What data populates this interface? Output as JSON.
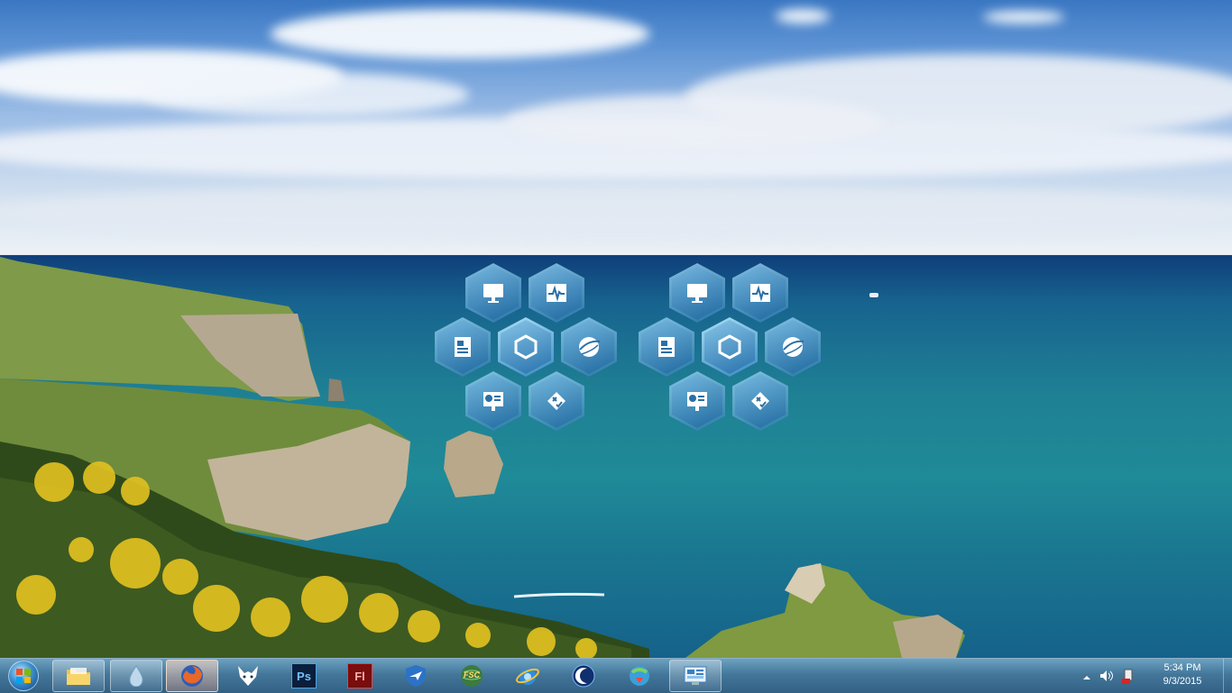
{
  "taskbar": {
    "start_button": "start-orb",
    "apps": [
      {
        "name": "Windows Explorer",
        "icon": "folder-icon"
      },
      {
        "name": "Droplet app",
        "icon": "droplet-icon"
      },
      {
        "name": "Firefox",
        "icon": "firefox-icon"
      },
      {
        "name": "Fox app",
        "icon": "fox-icon"
      },
      {
        "name": "Photoshop",
        "icon": "photoshop-icon",
        "label": "Ps"
      },
      {
        "name": "Flash",
        "icon": "flash-icon",
        "label": "Fl"
      },
      {
        "name": "Plane app",
        "icon": "plane-shield-icon"
      },
      {
        "name": "FSC",
        "icon": "fsc-globe-icon",
        "label": "FSC"
      },
      {
        "name": "Internet Explorer",
        "icon": "ie-icon"
      },
      {
        "name": "Crescent app",
        "icon": "crescent-icon"
      },
      {
        "name": "Download manager",
        "icon": "globe-arrow-icon"
      },
      {
        "name": "Control panel",
        "icon": "control-panel-icon"
      }
    ]
  },
  "tray": {
    "icons": [
      "chevron-up-icon",
      "speaker-icon",
      "usb-eject-icon"
    ]
  },
  "clock": {
    "time": "5:34 PM",
    "date": "9/3/2015"
  },
  "gadgets": [
    {
      "id": "gadget-1",
      "hexes": [
        "monitor-icon",
        "pulse-icon",
        "document-icon",
        "hexagon-icon",
        "globe-icon",
        "presentation-icon",
        "tools-icon"
      ]
    },
    {
      "id": "gadget-2",
      "hexes": [
        "monitor-icon",
        "pulse-icon",
        "document-icon",
        "hexagon-icon",
        "globe-icon",
        "presentation-icon",
        "tools-icon"
      ]
    }
  ],
  "colors": {
    "taskbar": "#4f7fa6",
    "hex_fill": "#5aa7d8",
    "sea": "#1f8194"
  }
}
